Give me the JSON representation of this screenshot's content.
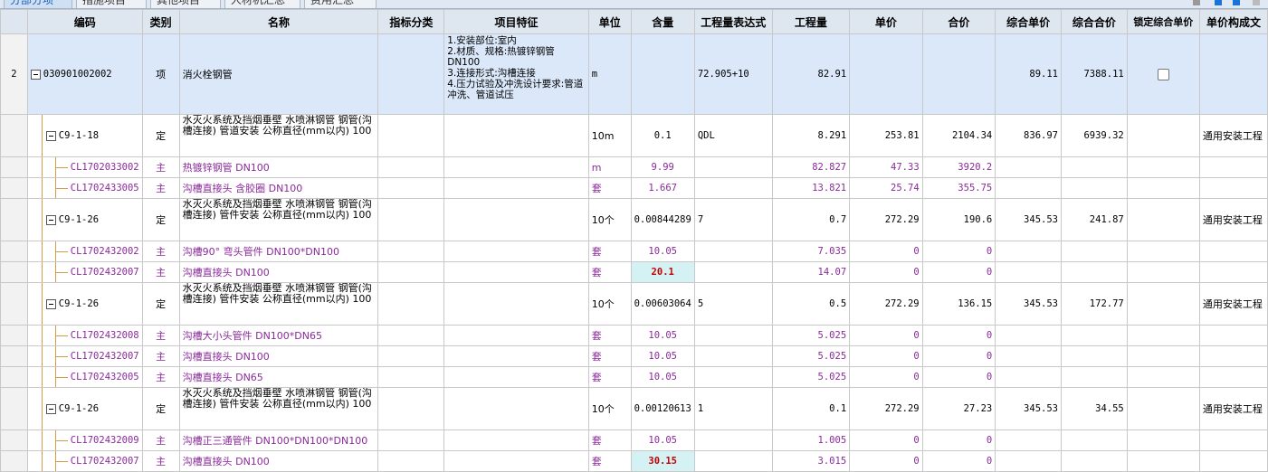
{
  "tabs": [
    "分部分项",
    "措施项目",
    "其他项目",
    "人材机汇总",
    "费用汇总"
  ],
  "columns": [
    "编码",
    "类别",
    "名称",
    "指标分类",
    "项目特征",
    "单位",
    "含量",
    "工程量表达式",
    "工程量",
    "单价",
    "合价",
    "综合单价",
    "综合合价",
    "锁定综合单价",
    "单价构成文"
  ],
  "main_row": {
    "rownum": "2",
    "code": "030901002002",
    "type": "项",
    "name": "消火栓钢管",
    "feature": "1.安装部位:室内\n2.材质、规格:热镀锌钢管DN100\n3.连接形式:沟槽连接\n4.压力试验及冲洗设计要求:管道冲洗、管道试压",
    "unit": "m",
    "qty_expr": "72.905+10",
    "qty": "82.91",
    "unit_total_price": "89.11",
    "total_price": "7388.11"
  },
  "rows": [
    {
      "kind": "quota",
      "code": "C9-1-18",
      "type": "定",
      "name": "水灭火系统及挡烟垂壁 水喷淋钢管 钢管(沟槽连接) 管道安装 公称直径(mm以内) 100",
      "unit": "10m",
      "content": "0.1",
      "expr": "QDL",
      "qty": "8.291",
      "price": "253.81",
      "amount": "2104.34",
      "uprice": "836.97",
      "utotal": "6939.32",
      "composition": "通用安装工程"
    },
    {
      "kind": "sub",
      "code": "CL1702033002",
      "type": "主",
      "name": "热镀锌钢管 DN100",
      "unit": "m",
      "content": "9.99",
      "qty": "82.827",
      "price": "47.33",
      "amount": "3920.2"
    },
    {
      "kind": "sub",
      "code": "CL1702433005",
      "type": "主",
      "name": "沟槽直接头 含胶圈 DN100",
      "unit": "套",
      "content": "1.667",
      "qty": "13.821",
      "price": "25.74",
      "amount": "355.75"
    },
    {
      "kind": "quota",
      "code": "C9-1-26",
      "type": "定",
      "name": "水灭火系统及挡烟垂壁 水喷淋钢管 钢管(沟槽连接) 管件安装 公称直径(mm以内) 100",
      "unit": "10个",
      "content": "0.00844289",
      "expr": "7",
      "qty": "0.7",
      "price": "272.29",
      "amount": "190.6",
      "uprice": "345.53",
      "utotal": "241.87",
      "composition": "通用安装工程"
    },
    {
      "kind": "sub",
      "code": "CL1702432002",
      "type": "主",
      "name": "沟槽90° 弯头管件 DN100*DN100",
      "unit": "套",
      "content": "10.05",
      "qty": "7.035",
      "price": "0",
      "amount": "0"
    },
    {
      "kind": "sub",
      "code": "CL1702432007",
      "type": "主",
      "name": "沟槽直接头 DN100",
      "unit": "套",
      "content": "20.1",
      "qty": "14.07",
      "price": "0",
      "amount": "0",
      "highlight": true
    },
    {
      "kind": "quota",
      "code": "C9-1-26",
      "type": "定",
      "name": "水灭火系统及挡烟垂壁 水喷淋钢管 钢管(沟槽连接) 管件安装 公称直径(mm以内) 100",
      "unit": "10个",
      "content": "0.00603064",
      "expr": "5",
      "qty": "0.5",
      "price": "272.29",
      "amount": "136.15",
      "uprice": "345.53",
      "utotal": "172.77",
      "composition": "通用安装工程"
    },
    {
      "kind": "sub",
      "code": "CL1702432008",
      "type": "主",
      "name": "沟槽大小头管件 DN100*DN65",
      "unit": "套",
      "content": "10.05",
      "qty": "5.025",
      "price": "0",
      "amount": "0"
    },
    {
      "kind": "sub",
      "code": "CL1702432007",
      "type": "主",
      "name": "沟槽直接头 DN100",
      "unit": "套",
      "content": "10.05",
      "qty": "5.025",
      "price": "0",
      "amount": "0"
    },
    {
      "kind": "sub",
      "code": "CL1702432005",
      "type": "主",
      "name": "沟槽直接头 DN65",
      "unit": "套",
      "content": "10.05",
      "qty": "5.025",
      "price": "0",
      "amount": "0"
    },
    {
      "kind": "quota",
      "code": "C9-1-26",
      "type": "定",
      "name": "水灭火系统及挡烟垂壁 水喷淋钢管 钢管(沟槽连接) 管件安装 公称直径(mm以内) 100",
      "unit": "10个",
      "content": "0.00120613",
      "expr": "1",
      "qty": "0.1",
      "price": "272.29",
      "amount": "27.23",
      "uprice": "345.53",
      "utotal": "34.55",
      "composition": "通用安装工程"
    },
    {
      "kind": "sub",
      "code": "CL1702432009",
      "type": "主",
      "name": "沟槽正三通管件 DN100*DN100*DN100",
      "unit": "套",
      "content": "10.05",
      "qty": "1.005",
      "price": "0",
      "amount": "0"
    },
    {
      "kind": "sub",
      "code": "CL1702432007",
      "type": "主",
      "name": "沟槽直接头 DN100",
      "unit": "套",
      "content": "30.15",
      "qty": "3.015",
      "price": "0",
      "amount": "0",
      "highlight": true
    }
  ],
  "colors": {
    "selected_row": "#dae8fa",
    "header": "#dee6f0",
    "sub_text": "#8a2a9a",
    "highlight_bg": "#d4f1f4",
    "highlight_text": "#c40000",
    "tree_line": "#d59b4a"
  }
}
